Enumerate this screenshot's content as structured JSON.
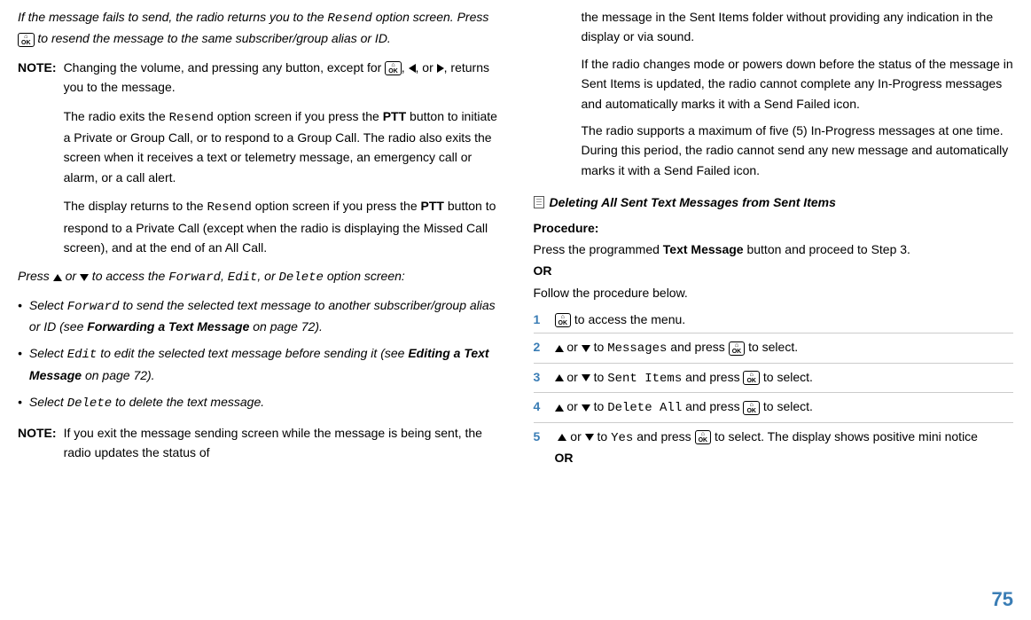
{
  "left": {
    "intro_pre": "If the message fails to send, the radio returns you to the ",
    "intro_code1": "Resend",
    "intro_mid": " option screen. Press ",
    "intro_post": " to resend the message to the same subscriber/group alias or ID.",
    "note_label": "NOTE:",
    "note1_pre": "Changing the volume, and pressing any button, except for ",
    "note1_mid1": ", ",
    "note1_mid2": ", or ",
    "note1_post": ", returns you to the message.",
    "note2_pre": "The radio exits the ",
    "note2_code": "Resend",
    "note2_mid": " option screen if you press the ",
    "note2_ptt": "PTT",
    "note2_post": " button to initiate a Private or Group Call, or to respond to a Group Call. The radio also exits the screen when it receives a text or telemetry message, an emergency call or alarm, or a call alert.",
    "note3_pre": "The display returns to the ",
    "note3_code": "Resend",
    "note3_mid": " option screen if you press the ",
    "note3_ptt": "PTT",
    "note3_post": " button to respond to a Private Call (except when the radio is displaying the Missed Call screen), and at the end of an All Call.",
    "press_pre": "Press ",
    "press_mid1": " or ",
    "press_mid2": " to access the ",
    "press_c1": "Forward",
    "press_sep1": ", ",
    "press_c2": "Edit",
    "press_sep2": ", or ",
    "press_c3": "Delete",
    "press_post": " option screen:",
    "b1_pre": "Select ",
    "b1_code": "Forward",
    "b1_mid": " to send the selected text message to another subscriber/group alias or ID (see ",
    "b1_bold": "Forwarding a Text Message",
    "b1_post": " on page 72).",
    "b2_pre": "Select ",
    "b2_code": "Edit",
    "b2_mid": " to edit the selected text message before sending it (see ",
    "b2_bold": "Editing a Text Message",
    "b2_post": " on page 72).",
    "b3_pre": "Select ",
    "b3_code": "Delete",
    "b3_post": " to delete the text message.",
    "note4": "If you exit the message sending screen while the message is being sent, the radio updates the status of"
  },
  "right": {
    "cont1": "the message in the Sent Items folder without providing any indication in the display or via sound.",
    "cont2": "If the radio changes mode or powers down before the status of the message in Sent Items is updated, the radio cannot complete any In-Progress messages and automatically marks it with a Send Failed icon.",
    "cont3": "The radio supports a maximum of five (5) In-Progress messages at one time. During this period, the radio cannot send any new message and automatically marks it with a Send Failed icon.",
    "section_title": "Deleting All Sent Text Messages from Sent Items",
    "proc_label": "Procedure:",
    "proc1_pre": "Press the programmed ",
    "proc1_bold": "Text Message",
    "proc1_post": " button and proceed to Step 3.",
    "or": "OR",
    "proc2": "Follow the procedure below.",
    "s1_num": "1",
    "s1_post": " to access the menu.",
    "s2_num": "2",
    "s2_mid1": " or ",
    "s2_mid2": " to ",
    "s2_code": "Messages",
    "s2_mid3": " and press ",
    "s2_post": " to select.",
    "s3_num": "3",
    "s3_code": "Sent Items",
    "s4_num": "4",
    "s4_code": "Delete All",
    "s5_num": "5",
    "s5_code": "Yes",
    "s5_post": " to select. The display shows positive mini notice"
  },
  "page_number": "75"
}
